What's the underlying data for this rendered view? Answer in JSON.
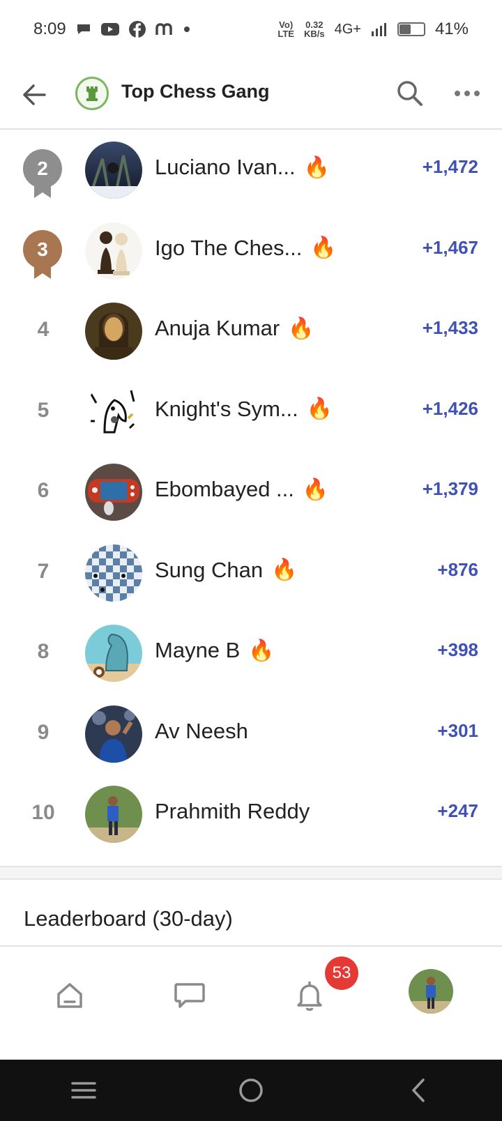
{
  "status_bar": {
    "time": "8:09",
    "net_speed_top": "0.32",
    "net_speed_bottom": "KB/s",
    "lte_top": "Vo)",
    "lte_bottom": "LTE",
    "network": "4G+",
    "battery": "41%",
    "battery_level": 0.41
  },
  "header": {
    "title": "Top Chess Gang"
  },
  "leaderboard": {
    "rows": [
      {
        "rank": "2",
        "name": "Luciano Ivan...",
        "score": "+1,472",
        "fire": true,
        "medal": "silver"
      },
      {
        "rank": "3",
        "name": "Igo The Ches...",
        "score": "+1,467",
        "fire": true,
        "medal": "bronze"
      },
      {
        "rank": "4",
        "name": "Anuja Kumar",
        "score": "+1,433",
        "fire": true,
        "medal": ""
      },
      {
        "rank": "5",
        "name": "Knight's Sym...",
        "score": "+1,426",
        "fire": true,
        "medal": ""
      },
      {
        "rank": "6",
        "name": "Ebombayed ...",
        "score": "+1,379",
        "fire": true,
        "medal": ""
      },
      {
        "rank": "7",
        "name": "Sung Chan",
        "score": "+876",
        "fire": true,
        "medal": ""
      },
      {
        "rank": "8",
        "name": "Mayne B",
        "score": "+398",
        "fire": true,
        "medal": ""
      },
      {
        "rank": "9",
        "name": "Av Neesh",
        "score": "+301",
        "fire": false,
        "medal": ""
      },
      {
        "rank": "10",
        "name": "Prahmith Reddy",
        "score": "+247",
        "fire": false,
        "medal": ""
      }
    ]
  },
  "section": {
    "title": "Leaderboard (30-day)"
  },
  "bottom_nav": {
    "notification_count": "53"
  },
  "colors": {
    "score": "#3f51b5",
    "fire": "#f26b1d",
    "silver": "#8e8e8e",
    "bronze": "#a87651",
    "badge": "#e53935",
    "club_green": "#7bb661"
  }
}
